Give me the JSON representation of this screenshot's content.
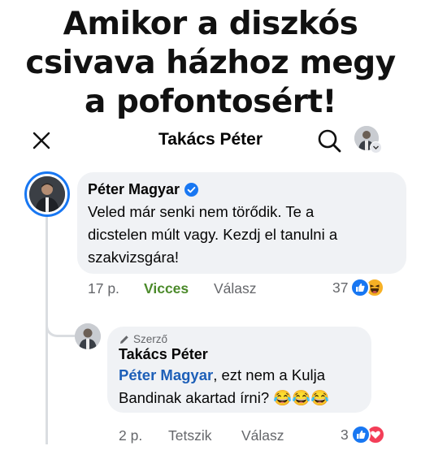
{
  "meme": {
    "line1": "Amikor a diszkós",
    "line2": "csivava házhoz megy",
    "line3": "a pofontosért!"
  },
  "header": {
    "title": "Takács Péter",
    "close_icon": "close-icon",
    "search_icon": "search-icon"
  },
  "comment": {
    "author": "Péter Magyar",
    "text_line1": "Veled már senki nem törődik. Te a",
    "text_line2": "dicstelen múlt vagy. Kezdj el tanulni a",
    "text_line3": "szakvizsgára!",
    "time": "17 p.",
    "reaction_label": "Vicces",
    "reply_label": "Válasz",
    "reaction_count": "37"
  },
  "reply": {
    "badge": "Szerző",
    "author": "Takács Péter",
    "mention": "Péter Magyar",
    "text_rest": ", ezt nem a Kulja",
    "text_line2": "Bandinak akartad írni?",
    "emoji": "😂😂😂",
    "time": "2 p.",
    "like_label": "Tetszik",
    "reply_label": "Válasz",
    "reaction_count": "3"
  },
  "colors": {
    "link_blue": "#1d5fb8",
    "verified_blue": "#1877f2",
    "reaction_green": "#4b8a2a",
    "bubble_bg": "#f0f2f5",
    "muted": "#65676b"
  }
}
